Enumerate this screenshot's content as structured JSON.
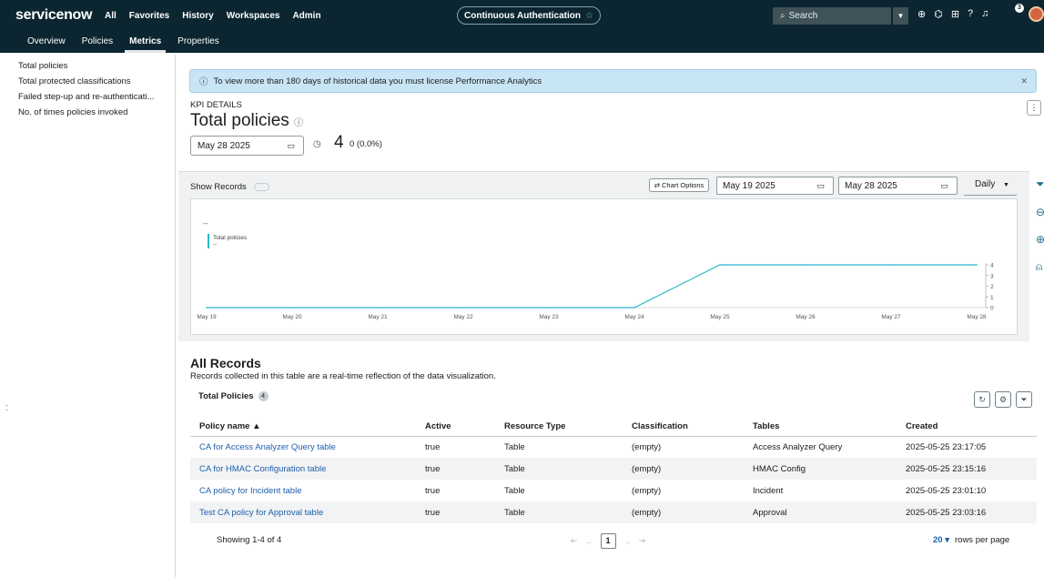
{
  "topbar": {
    "logo": "servicenow",
    "nav": [
      "All",
      "Favorites",
      "History",
      "Workspaces",
      "Admin"
    ],
    "context": "Continuous Authentication",
    "search_placeholder": "Search",
    "notification_count": "3"
  },
  "tabs": [
    "Overview",
    "Policies",
    "Metrics",
    "Properties"
  ],
  "active_tab": "Metrics",
  "sidebar": [
    "Total policies",
    "Total protected classifications",
    "Failed step-up and re-authenticati...",
    "No. of times policies invoked"
  ],
  "banner": "To view more than 180 days of historical data you must license Performance Analytics",
  "kpi": {
    "label": "KPI DETAILS",
    "title": "Total policies",
    "date": "May 28 2025",
    "value": "4",
    "change": "0 (0.0%)"
  },
  "chart_controls": {
    "show_records": "Show Records",
    "chart_options": "Chart Options",
    "start_date": "May 19 2025",
    "end_date": "May 28 2025",
    "interval": "Daily"
  },
  "chart_data": {
    "type": "line",
    "legend_top": "--",
    "series": [
      {
        "name": "Total policies",
        "sub": "--",
        "values": [
          0,
          0,
          0,
          0,
          0,
          0,
          4,
          4,
          4,
          4
        ]
      }
    ],
    "categories": [
      "May 19",
      "May 20",
      "May 21",
      "May 22",
      "May 23",
      "May 24",
      "May 25",
      "May 26",
      "May 27",
      "May 28"
    ],
    "yticks": [
      0,
      1,
      2,
      3,
      4
    ],
    "ylim": [
      0,
      4
    ],
    "color": "#29b6d1"
  },
  "records": {
    "title": "All Records",
    "subtitle": "Records collected in this table are a real-time reflection of the data visualization.",
    "list_title": "Total Policies",
    "count": "4",
    "columns": [
      "Policy name ▲",
      "Active",
      "Resource Type",
      "Classification",
      "Tables",
      "Created"
    ],
    "rows": [
      [
        "CA for Access Analyzer Query table",
        "true",
        "Table",
        "(empty)",
        "Access Analyzer Query",
        "2025-05-25 23:17:05"
      ],
      [
        "CA for HMAC Configuration table",
        "true",
        "Table",
        "(empty)",
        "HMAC Config",
        "2025-05-25 23:15:16"
      ],
      [
        "CA policy for Incident table",
        "true",
        "Table",
        "(empty)",
        "Incident",
        "2025-05-25 23:01:10"
      ],
      [
        "Test CA policy for Approval table",
        "true",
        "Table",
        "(empty)",
        "Approval",
        "2025-05-25 23:03:16"
      ]
    ],
    "showing": "Showing 1-4 of 4",
    "page": "1",
    "rows_per_page": "20",
    "rows_per_page_label": "rows per page"
  }
}
